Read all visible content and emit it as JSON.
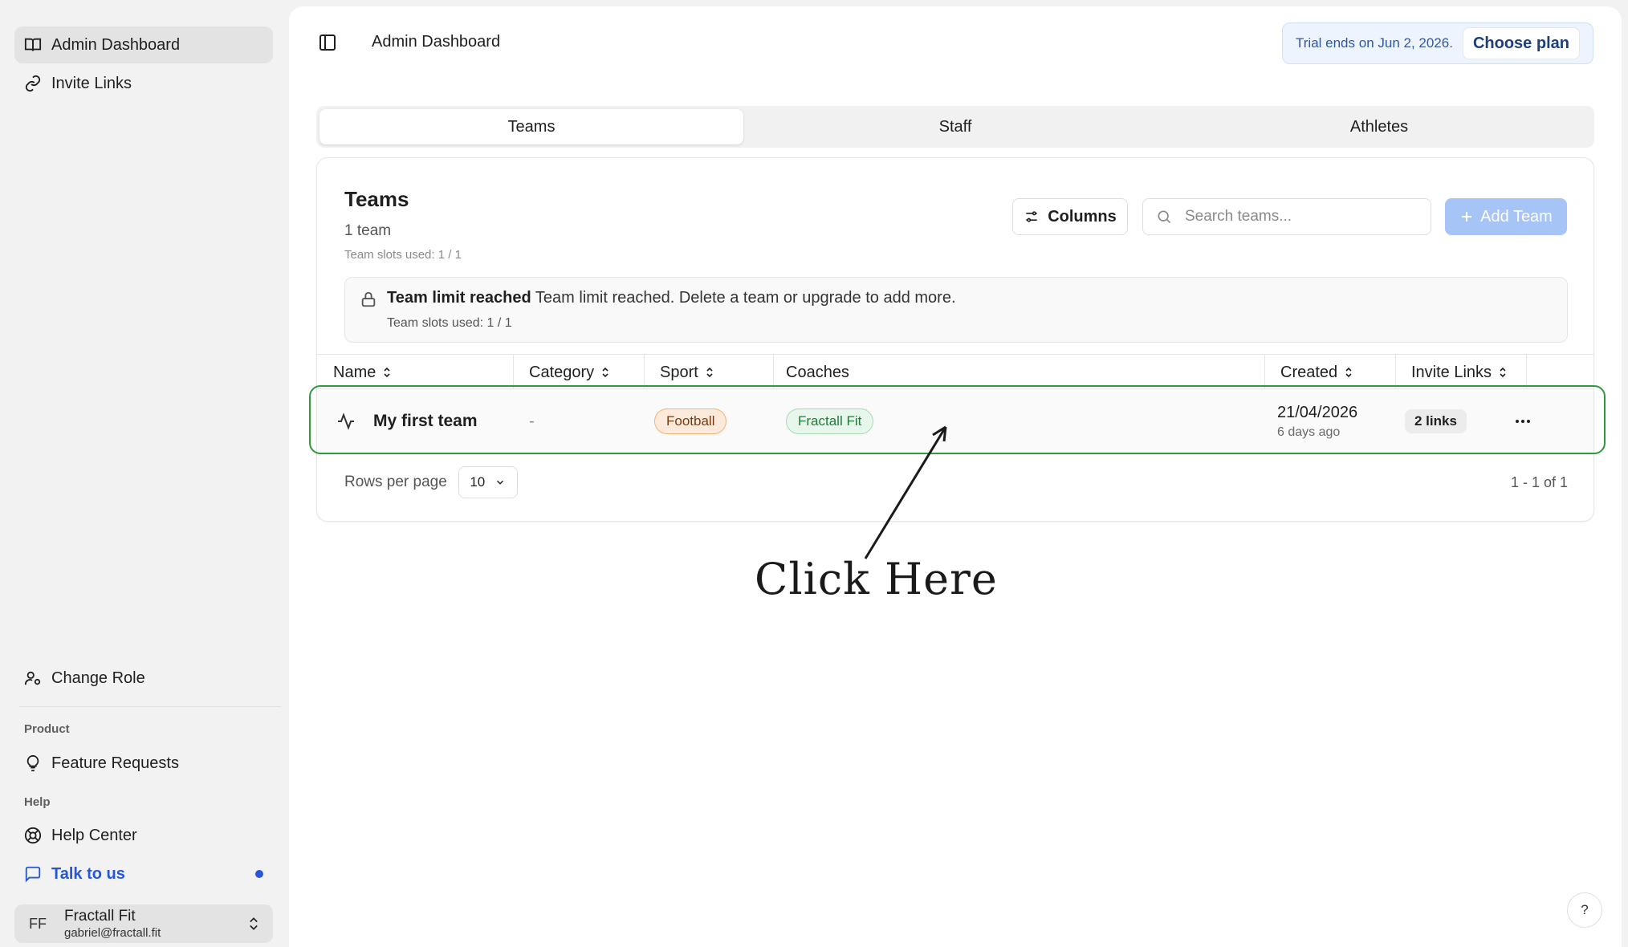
{
  "sidebar": {
    "items": [
      {
        "label": "Admin Dashboard",
        "icon": "book-open-icon"
      },
      {
        "label": "Invite Links",
        "icon": "link-icon"
      }
    ],
    "change_role": "Change Role",
    "product_label": "Product",
    "feature_requests": "Feature Requests",
    "help_label": "Help",
    "help_center": "Help Center",
    "talk_to_us": "Talk to us",
    "user": {
      "initials": "FF",
      "name": "Fractall Fit",
      "email": "gabriel@fractall.fit"
    }
  },
  "header": {
    "title": "Admin Dashboard",
    "trial_text": "Trial ends on Jun 2, 2026.",
    "choose_plan": "Choose plan"
  },
  "tabs": [
    "Teams",
    "Staff",
    "Athletes"
  ],
  "active_tab": "Teams",
  "teams": {
    "title": "Teams",
    "count": "1 team",
    "slots": "Team slots used: 1 / 1",
    "columns_button": "Columns",
    "search_placeholder": "Search teams...",
    "add_button": "Add Team",
    "alert_title": "Team limit reached",
    "alert_message": "Team limit reached. Delete a team or upgrade to add more.",
    "alert_slots": "Team slots used: 1 / 1",
    "columns": [
      "Name",
      "Category",
      "Sport",
      "Coaches",
      "Created",
      "Invite Links"
    ],
    "rows": [
      {
        "name": "My first team",
        "category": "-",
        "sport": "Football",
        "coach": "Fractall Fit",
        "created": "21/04/2026",
        "created_ago": "6 days ago",
        "links": "2 links"
      }
    ],
    "rows_per_page_label": "Rows per page",
    "rows_per_page": "10",
    "pagination": "1 - 1 of 1"
  },
  "annotation": "Click Here",
  "help_button": "?",
  "colors": {
    "accent": "#2557d6",
    "highlight": "#2f9a3d",
    "add_button": "#a7c4f7"
  }
}
